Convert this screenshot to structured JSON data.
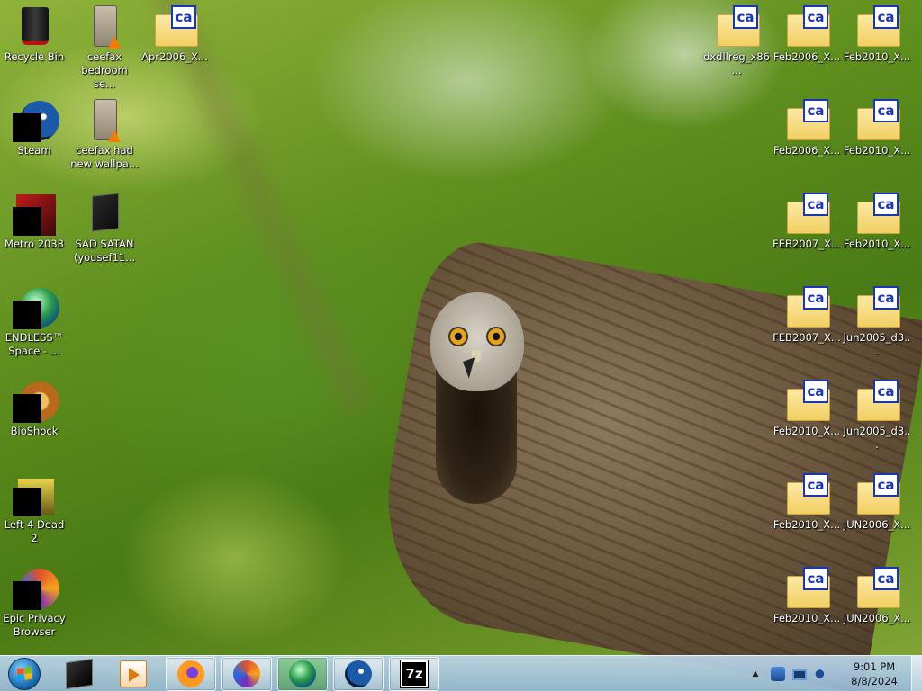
{
  "desktop": {
    "left_icons": [
      {
        "name": "recycle-bin",
        "label": "Recycle Bin",
        "kind": "recycle"
      },
      {
        "name": "steam",
        "label": "Steam",
        "kind": "app",
        "color": "#1b5aa8"
      },
      {
        "name": "metro-2033",
        "label": "Metro 2033",
        "kind": "app",
        "color": "#b01818"
      },
      {
        "name": "endless-space",
        "label": "ENDLESS™ Space - ...",
        "kind": "app",
        "color": "#2a8a3a"
      },
      {
        "name": "bioshock",
        "label": "BioShock",
        "kind": "app",
        "color": "#c27a2a"
      },
      {
        "name": "left-4-dead-2",
        "label": "Left 4 Dead 2",
        "kind": "app",
        "color": "#d8c03a"
      },
      {
        "name": "epic-privacy-browser",
        "label": "Epic Privacy Browser",
        "kind": "app",
        "color": "#e2532a"
      }
    ],
    "second_col_icons": [
      {
        "name": "ceefax-bedroom",
        "label": "ceefax bedroom se...",
        "kind": "video"
      },
      {
        "name": "ceefax-wallpaper",
        "label": "ceefax had new wallpa...",
        "kind": "video"
      },
      {
        "name": "sad-satan",
        "label": "SAD SATAN (yousef11...",
        "kind": "file"
      }
    ],
    "third_col_icons": [
      {
        "name": "apr2006-x",
        "label": "Apr2006_X...",
        "kind": "folder"
      }
    ],
    "right_col1": [
      {
        "name": "dxdllreg",
        "label": "dxdllreg_x86..."
      }
    ],
    "right_col2": [
      {
        "label": "Feb2006_X..."
      },
      {
        "label": "Feb2006_X..."
      },
      {
        "label": "FEB2007_X..."
      },
      {
        "label": "FEB2007_X..."
      },
      {
        "label": "Feb2010_X..."
      },
      {
        "label": "Feb2010_X..."
      },
      {
        "label": "Feb2010_X..."
      }
    ],
    "right_col3": [
      {
        "label": "Feb2010_X..."
      },
      {
        "label": "Feb2010_X..."
      },
      {
        "label": "Feb2010_X..."
      },
      {
        "label": "Jun2005_d3..."
      },
      {
        "label": "Jun2005_d3..."
      },
      {
        "label": "JUN2006_X..."
      },
      {
        "label": "JUN2006_X..."
      }
    ],
    "folder_badge": "ca"
  },
  "taskbar": {
    "start_label": "Start",
    "pinned": [
      {
        "name": "terminal-app",
        "kind": "pinned"
      },
      {
        "name": "media-player",
        "kind": "pinned"
      },
      {
        "name": "firefox",
        "kind": "running"
      },
      {
        "name": "epic-browser",
        "kind": "running"
      },
      {
        "name": "internet-download-manager",
        "kind": "active"
      },
      {
        "name": "steam",
        "kind": "running"
      },
      {
        "name": "7zip",
        "kind": "running",
        "text": "7z"
      }
    ],
    "tray": {
      "chevron": "▲",
      "time": "9:01 PM",
      "date": "8/8/2024"
    }
  }
}
